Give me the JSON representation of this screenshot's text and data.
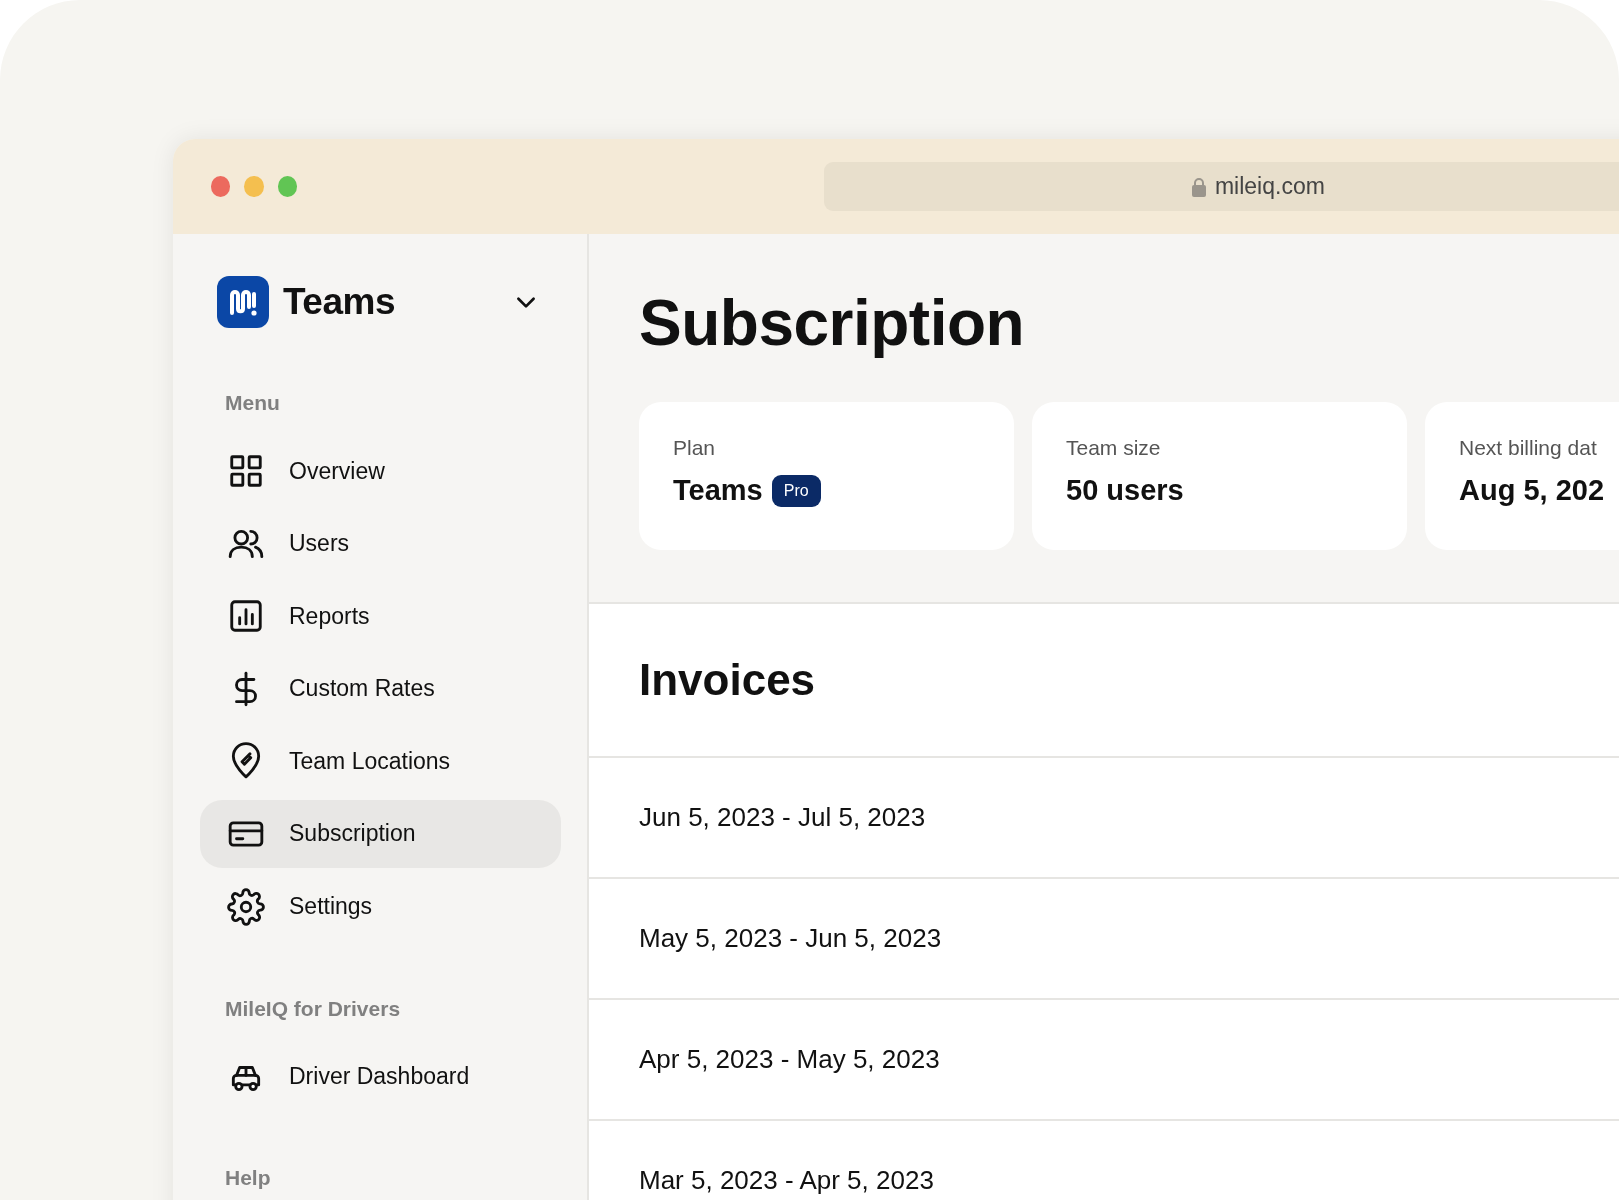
{
  "browser": {
    "url": "mileiq.com"
  },
  "sidebar": {
    "brand": "Teams",
    "sections": [
      {
        "heading": "Menu",
        "items": [
          {
            "kind": "grid",
            "label": "Overview",
            "selected": false
          },
          {
            "kind": "people",
            "label": "Users",
            "selected": false
          },
          {
            "kind": "chart",
            "label": "Reports",
            "selected": false
          },
          {
            "kind": "dollar",
            "label": "Custom Rates",
            "selected": false
          },
          {
            "kind": "pin",
            "label": "Team Locations",
            "selected": false
          },
          {
            "kind": "card",
            "label": "Subscription",
            "selected": true
          },
          {
            "kind": "gear",
            "label": "Settings",
            "selected": false
          }
        ]
      },
      {
        "heading": "MileIQ for Drivers",
        "items": [
          {
            "kind": "car",
            "label": "Driver Dashboard",
            "selected": false
          }
        ]
      },
      {
        "heading": "Help"
      }
    ]
  },
  "main": {
    "title": "Subscription",
    "cards": [
      {
        "label": "Plan",
        "value": "Teams",
        "badge": "Pro"
      },
      {
        "label": "Team size",
        "value": "50 users"
      },
      {
        "label": "Next billing dat",
        "value": "Aug 5, 202"
      }
    ],
    "invoices": {
      "title": "Invoices",
      "rows": [
        "Jun 5, 2023 - Jul 5, 2023",
        "May 5, 2023 - Jun 5, 2023",
        "Apr 5, 2023 - May 5, 2023",
        "Mar 5, 2023 - Apr 5, 2023"
      ]
    }
  }
}
